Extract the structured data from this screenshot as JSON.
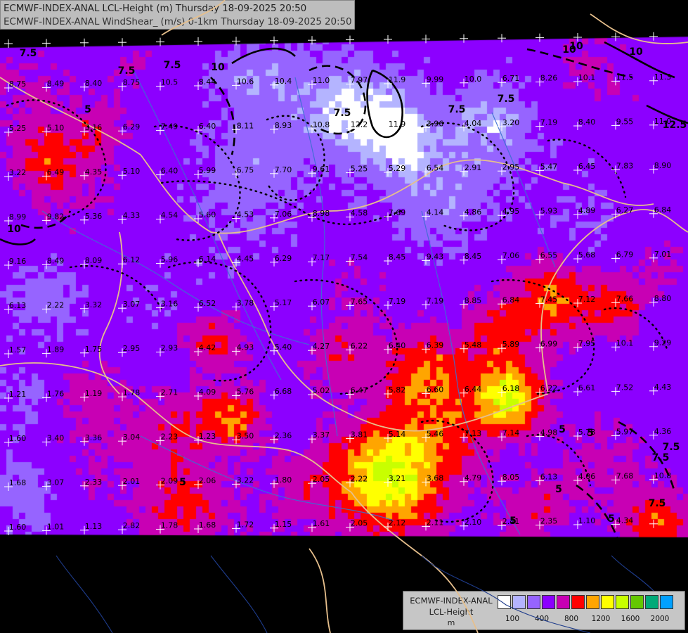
{
  "header": {
    "title_line1": "ECMWF-INDEX-ANAL LCL-Height (m) Thursday 18-09-2025 20:50",
    "title_line2": "ECMWF-INDEX-ANAL WindShear_ (m/s) 0-1km Thursday 18-09-2025 20:50"
  },
  "legend": {
    "line1": "ECMWF-INDEX-ANAL",
    "line2": "LCL-Height",
    "line3": "m",
    "swatch_colors": [
      "#ffffff",
      "#b4b4ff",
      "#9664ff",
      "#8c00ff",
      "#c800b4",
      "#ff0000",
      "#ffa500",
      "#ffff00",
      "#c8ff00",
      "#64c800",
      "#00aa78",
      "#00a0ff"
    ],
    "tick_labels": [
      "100",
      "400",
      "800",
      "1200",
      "1600",
      "2000"
    ]
  },
  "contour_labels": {
    "solid": [
      "7.5",
      "10",
      "10",
      "7.5",
      "12.5",
      "10",
      "7.5",
      "10",
      "7.5",
      "5",
      "7.5",
      "10",
      "10",
      "7.5"
    ],
    "dashed": [
      "7.5",
      "7.5",
      "5",
      "7.5",
      "5",
      "5",
      "5",
      "5",
      "5",
      "5"
    ]
  },
  "grid_values": [
    [
      "8.75",
      "8.49",
      "8.40",
      "8.75",
      "10.5",
      "8.44",
      "10.6",
      "10.4",
      "11.0",
      "7.97",
      "11.9",
      "9.99",
      "10.0",
      "6.71",
      "8.26",
      "10.1",
      "11.5",
      "11.3"
    ],
    [
      "5.25",
      "5.10",
      "3.16",
      "6.29",
      "7.49",
      "6.40",
      "8.11",
      "8.93",
      "10.8",
      "12.2",
      "11.9",
      "3.96",
      "4.04",
      "3.20",
      "7.19",
      "8.40",
      "9.55",
      "11.0"
    ],
    [
      "3.22",
      "6.49",
      "4.35",
      "5.10",
      "6.40",
      "5.99",
      "6.75",
      "7.70",
      "9.61",
      "5.25",
      "5.29",
      "6.54",
      "2.91",
      "2.95",
      "5.47",
      "6.45",
      "7.83",
      "8.90"
    ],
    [
      "8.99",
      "9.82",
      "5.36",
      "4.33",
      "4.54",
      "5.60",
      "4.53",
      "7.06",
      "8.98",
      "4.58",
      "7.69",
      "4.14",
      "4.86",
      "4.95",
      "5.93",
      "4.89",
      "6.27",
      "6.84"
    ],
    [
      "9.16",
      "8.49",
      "8.09",
      "6.12",
      "5.96",
      "6.14",
      "4.45",
      "6.29",
      "7.17",
      "7.54",
      "8.45",
      "9.43",
      "8.45",
      "7.06",
      "6.55",
      "5.68",
      "6.79",
      "7.01"
    ],
    [
      "6.13",
      "2.22",
      "3.32",
      "3.07",
      "3.16",
      "6.52",
      "3.78",
      "5.17",
      "6.07",
      "7.65",
      "7.19",
      "7.19",
      "8.85",
      "6.84",
      "7.45",
      "7.12",
      "7.66",
      "8.80"
    ],
    [
      "1.57",
      "1.89",
      "1.75",
      "2.95",
      "2.93",
      "4.42",
      "4.93",
      "5.40",
      "4.27",
      "6.22",
      "6.40",
      "6.39",
      "5.48",
      "5.89",
      "6.99",
      "7.95",
      "10.1",
      "9.29"
    ],
    [
      "1.21",
      "1.76",
      "1.19",
      "1.78",
      "2.71",
      "4.09",
      "5.76",
      "6.68",
      "5.02",
      "6.47",
      "5.82",
      "6.60",
      "6.44",
      "6.18",
      "6.22",
      "6.61",
      "7.52",
      "4.43"
    ],
    [
      "1.60",
      "3.40",
      "3.36",
      "3.04",
      "2.23",
      "1.23",
      "3.50",
      "2.36",
      "3.37",
      "3.81",
      "5.14",
      "5.46",
      "7.13",
      "7.14",
      "4.98",
      "5.78",
      "5.97",
      "4.36"
    ],
    [
      "1.68",
      "3.07",
      "2.33",
      "2.01",
      "2.09",
      "2.06",
      "3.22",
      "1.80",
      "2.05",
      "2.22",
      "3.21",
      "3.68",
      "4.79",
      "8.05",
      "6.13",
      "4.06",
      "7.68",
      "10.8"
    ],
    [
      "1.60",
      "1.01",
      "1.13",
      "2.82",
      "1.78",
      "1.68",
      "1.72",
      "1.15",
      "1.61",
      "2.05",
      "2.12",
      "2.11",
      "2.10",
      "2.41",
      "2.35",
      "1.10",
      "4.34"
    ]
  ]
}
